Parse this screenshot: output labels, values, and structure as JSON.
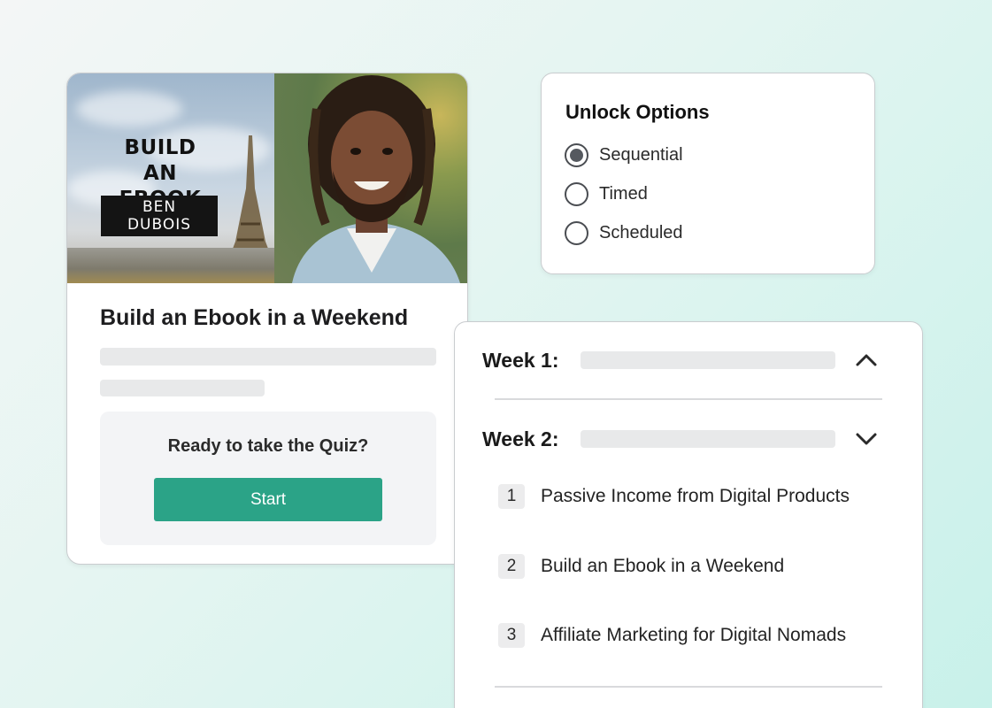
{
  "course": {
    "hero_title_line1": "BUILD AN",
    "hero_title_line2": "EBOOK",
    "hero_author": "BEN DUBOIS",
    "title": "Build an Ebook in a Weekend",
    "quiz_prompt": "Ready to take the Quiz?",
    "start_label": "Start",
    "accent_color": "#2ba387"
  },
  "unlock": {
    "title": "Unlock Options",
    "options": [
      {
        "label": "Sequential",
        "checked": true
      },
      {
        "label": "Timed",
        "checked": false
      },
      {
        "label": "Scheduled",
        "checked": false
      }
    ]
  },
  "curriculum": {
    "weeks": [
      {
        "label": "Week 1:",
        "expanded": false,
        "chevron_icon": "chevron-up-icon"
      },
      {
        "label": "Week 2:",
        "expanded": true,
        "chevron_icon": "chevron-down-icon"
      }
    ],
    "lessons": [
      {
        "num": "1",
        "title": "Passive Income from Digital Products"
      },
      {
        "num": "2",
        "title": "Build an Ebook in a Weekend"
      },
      {
        "num": "3",
        "title": "Affiliate Marketing for Digital Nomads"
      }
    ]
  }
}
